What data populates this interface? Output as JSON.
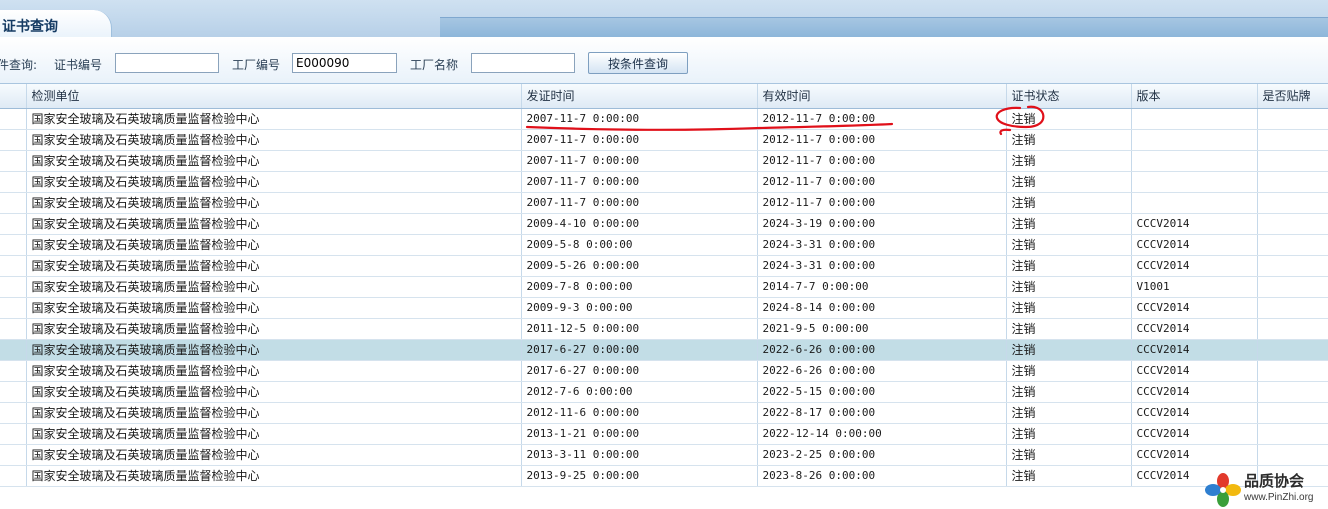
{
  "tab": {
    "title": "证书查询"
  },
  "search": {
    "prefix_label": "件查询:",
    "cert_no_label": "证书编号",
    "cert_no_value": "",
    "factory_no_label": "工厂编号",
    "factory_no_value": "E000090",
    "factory_name_label": "工厂名称",
    "factory_name_value": "",
    "button_label": "按条件查询"
  },
  "table": {
    "headers": [
      "检测单位",
      "发证时间",
      "有效时间",
      "证书状态",
      "版本",
      "是否贴牌"
    ],
    "rows": [
      [
        "国家安全玻璃及石英玻璃质量监督检验中心",
        "2007-11-7 0:00:00",
        "2012-11-7 0:00:00",
        "注销",
        "",
        ""
      ],
      [
        "国家安全玻璃及石英玻璃质量监督检验中心",
        "2007-11-7 0:00:00",
        "2012-11-7 0:00:00",
        "注销",
        "",
        ""
      ],
      [
        "国家安全玻璃及石英玻璃质量监督检验中心",
        "2007-11-7 0:00:00",
        "2012-11-7 0:00:00",
        "注销",
        "",
        ""
      ],
      [
        "国家安全玻璃及石英玻璃质量监督检验中心",
        "2007-11-7 0:00:00",
        "2012-11-7 0:00:00",
        "注销",
        "",
        ""
      ],
      [
        "国家安全玻璃及石英玻璃质量监督检验中心",
        "2007-11-7 0:00:00",
        "2012-11-7 0:00:00",
        "注销",
        "",
        ""
      ],
      [
        "国家安全玻璃及石英玻璃质量监督检验中心",
        "2009-4-10 0:00:00",
        "2024-3-19 0:00:00",
        "注销",
        "CCCV2014",
        ""
      ],
      [
        "国家安全玻璃及石英玻璃质量监督检验中心",
        "2009-5-8 0:00:00",
        "2024-3-31 0:00:00",
        "注销",
        "CCCV2014",
        ""
      ],
      [
        "国家安全玻璃及石英玻璃质量监督检验中心",
        "2009-5-26 0:00:00",
        "2024-3-31 0:00:00",
        "注销",
        "CCCV2014",
        ""
      ],
      [
        "国家安全玻璃及石英玻璃质量监督检验中心",
        "2009-7-8 0:00:00",
        "2014-7-7 0:00:00",
        "注销",
        "V1001",
        ""
      ],
      [
        "国家安全玻璃及石英玻璃质量监督检验中心",
        "2009-9-3 0:00:00",
        "2024-8-14 0:00:00",
        "注销",
        "CCCV2014",
        ""
      ],
      [
        "国家安全玻璃及石英玻璃质量监督检验中心",
        "2011-12-5 0:00:00",
        "2021-9-5 0:00:00",
        "注销",
        "CCCV2014",
        ""
      ],
      [
        "国家安全玻璃及石英玻璃质量监督检验中心",
        "2017-6-27 0:00:00",
        "2022-6-26 0:00:00",
        "注销",
        "CCCV2014",
        ""
      ],
      [
        "国家安全玻璃及石英玻璃质量监督检验中心",
        "2017-6-27 0:00:00",
        "2022-6-26 0:00:00",
        "注销",
        "CCCV2014",
        ""
      ],
      [
        "国家安全玻璃及石英玻璃质量监督检验中心",
        "2012-7-6 0:00:00",
        "2022-5-15 0:00:00",
        "注销",
        "CCCV2014",
        ""
      ],
      [
        "国家安全玻璃及石英玻璃质量监督检验中心",
        "2012-11-6 0:00:00",
        "2022-8-17 0:00:00",
        "注销",
        "CCCV2014",
        ""
      ],
      [
        "国家安全玻璃及石英玻璃质量监督检验中心",
        "2013-1-21 0:00:00",
        "2022-12-14 0:00:00",
        "注销",
        "CCCV2014",
        ""
      ],
      [
        "国家安全玻璃及石英玻璃质量监督检验中心",
        "2013-3-11 0:00:00",
        "2023-2-25 0:00:00",
        "注销",
        "CCCV2014",
        ""
      ],
      [
        "国家安全玻璃及石英玻璃质量监督检验中心",
        "2013-9-25 0:00:00",
        "2023-8-26 0:00:00",
        "注销",
        "CCCV2014",
        ""
      ]
    ],
    "highlighted_row": 11
  },
  "watermark": {
    "name": "品质协会",
    "url": "www.PinZhi.org"
  },
  "colors": {
    "annotation": "#e0101a",
    "highlight_row": "#c2dde6",
    "header_blue": "#153b63"
  }
}
